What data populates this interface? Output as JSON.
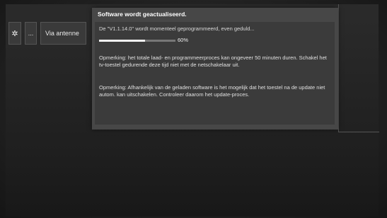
{
  "sidebar": {
    "settings_icon": "gear-icon",
    "more_label": "...",
    "source_label": "Via antenne"
  },
  "dialog": {
    "title": "Software wordt geactualiseerd.",
    "status": "De \"V1.1.14.0\" wordt momenteel geprogrammeerd, even geduld...",
    "progress_percent": 60,
    "progress_label": "60%",
    "note1": "Opmerking: het totale laad- en programmeerproces kan ongeveer 50 minuten duren. Schakel het tv-toestel gedurende deze tijd niet met de netschakelaar uit.",
    "note2": "Opmerking: Afhankelijk van de geladen software is het mogelijk dat het toestel na de update niet autom. kan uitschakelen. Controleer daarom het update-proces."
  },
  "colors": {
    "dialog_bg": "#474747",
    "progress_fill": "#f2f2f2"
  }
}
